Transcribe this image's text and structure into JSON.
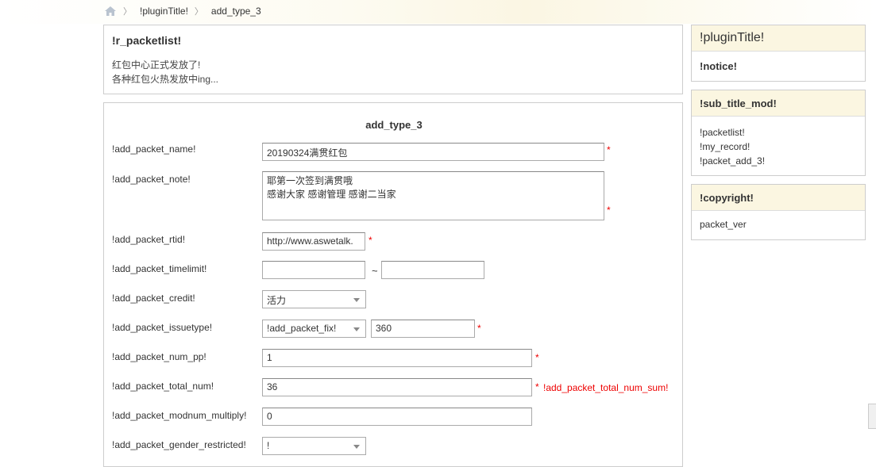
{
  "breadcrumb": {
    "home_icon": "home-icon",
    "items": [
      "!pluginTitle!",
      "add_type_3"
    ]
  },
  "intro": {
    "title": "!r_packetlist!",
    "line1": "红包中心正式发放了!",
    "line2": "各种红包火热发放中ing..."
  },
  "form": {
    "title": "add_type_3",
    "required_mark": "*",
    "name": {
      "label": "!add_packet_name!",
      "value": "20190324满贯红包"
    },
    "note": {
      "label": "!add_packet_note!",
      "value": "耶第一次签到满贯哦\n感谢大家 感谢管理 感谢二当家"
    },
    "rtid": {
      "label": "!add_packet_rtid!",
      "value": "http://www.aswetalk."
    },
    "timelimit": {
      "label": "!add_packet_timelimit!",
      "start": "",
      "end": "",
      "separator": "~"
    },
    "credit": {
      "label": "!add_packet_credit!",
      "selected": "活力"
    },
    "issuetype": {
      "label": "!add_packet_issuetype!",
      "selected": "!add_packet_fix!",
      "amount": "360"
    },
    "num_pp": {
      "label": "!add_packet_num_pp!",
      "value": "1"
    },
    "total_num": {
      "label": "!add_packet_total_num!",
      "value": "36",
      "note": "!add_packet_total_num_sum!"
    },
    "modnum": {
      "label": "!add_packet_modnum_multiply!",
      "value": "0"
    },
    "gender": {
      "label": "!add_packet_gender_restricted!",
      "selected": "!"
    }
  },
  "sidebar": {
    "plugin": {
      "title": "!pluginTitle!",
      "notice": "!notice!"
    },
    "submenu": {
      "title": "!sub_title_mod!",
      "items": [
        "!packetlist!",
        "!my_record!",
        "!packet_add_3!"
      ]
    },
    "copyright": {
      "title": "!copyright!",
      "text": "packet_ver"
    }
  },
  "colors": {
    "required": "#e00000",
    "header_bg": "#fbf6e1",
    "border": "#cdcdcd"
  }
}
